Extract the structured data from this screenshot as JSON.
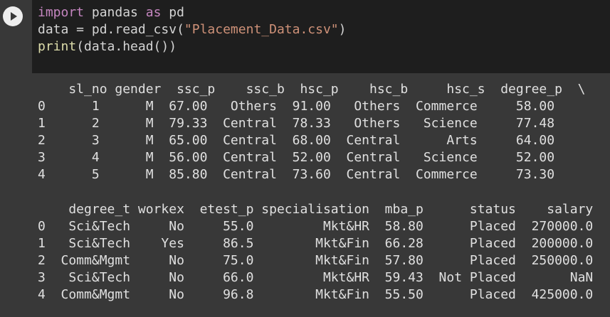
{
  "code": {
    "line1": {
      "kw_import": "import",
      "module": " pandas ",
      "kw_as": "as",
      "alias": " pd"
    },
    "line2": {
      "prefix": "data = pd.read_csv(",
      "filename": "\"Placement_Data.csv\"",
      "suffix": ")"
    },
    "line3": {
      "fn": "print",
      "args": "(data.head())"
    }
  },
  "output": {
    "table1": {
      "header": "    sl_no gender  ssc_p    ssc_b  hsc_p    hsc_b     hsc_s  degree_p  \\",
      "rows": [
        "0      1      M  67.00   Others  91.00   Others  Commerce     58.00",
        "1      2      M  79.33  Central  78.33   Others   Science     77.48",
        "2      3      M  65.00  Central  68.00  Central      Arts     64.00",
        "3      4      M  56.00  Central  52.00  Central   Science     52.00",
        "4      5      M  85.80  Central  73.60  Central  Commerce     73.30"
      ]
    },
    "table2": {
      "header": "    degree_t workex  etest_p specialisation  mba_p      status    salary",
      "rows": [
        "0   Sci&Tech     No     55.0         Mkt&HR  58.80      Placed  270000.0",
        "1   Sci&Tech    Yes     86.5        Mkt&Fin  66.28      Placed  200000.0",
        "2  Comm&Mgmt     No     75.0        Mkt&Fin  57.80      Placed  250000.0",
        "3   Sci&Tech     No     66.0         Mkt&HR  59.43  Not Placed       NaN",
        "4  Comm&Mgmt     No     96.8        Mkt&Fin  55.50      Placed  425000.0"
      ]
    }
  }
}
